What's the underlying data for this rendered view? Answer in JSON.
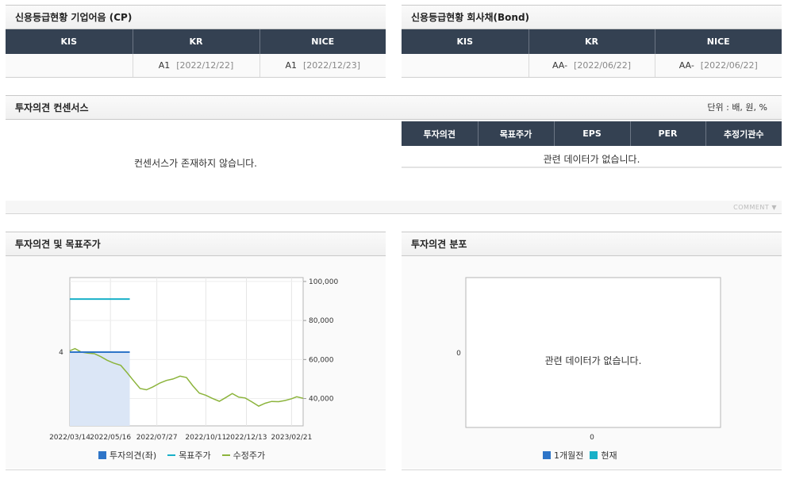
{
  "cp": {
    "title": "신용등급현황 기업어음 (CP)",
    "headers": [
      "KIS",
      "KR",
      "NICE"
    ],
    "row": [
      {
        "grade": "",
        "date": ""
      },
      {
        "grade": "A1",
        "date": "[2022/12/22]"
      },
      {
        "grade": "A1",
        "date": "[2022/12/23]"
      }
    ]
  },
  "bond": {
    "title": "신용등급현황 회사채(Bond)",
    "headers": [
      "KIS",
      "KR",
      "NICE"
    ],
    "row": [
      {
        "grade": "",
        "date": ""
      },
      {
        "grade": "AA-",
        "date": "[2022/06/22]"
      },
      {
        "grade": "AA-",
        "date": "[2022/06/22]"
      }
    ]
  },
  "consensus": {
    "title": "투자의견 컨센서스",
    "unit": "단위 : 배, 원, %",
    "empty_message": "컨센서스가 존재하지 않습니다.",
    "headers": [
      "투자의견",
      "목표주가",
      "EPS",
      "PER",
      "추정기관수"
    ],
    "no_data": "관련 데이터가 없습니다.",
    "comment_label": "COMMENT"
  },
  "opinion_chart": {
    "title": "투자의견 및 목표주가",
    "legend": [
      "투자의견(좌)",
      "목표주가",
      "수정주가"
    ]
  },
  "distribution": {
    "title": "투자의견 분포",
    "no_data": "관련 데이터가 없습니다.",
    "legend": [
      "1개월전",
      "현재"
    ]
  },
  "chart_data": [
    {
      "type": "line",
      "title": "투자의견 및 목표주가",
      "x_ticks": [
        "2022/03/14",
        "2022/05/16",
        "2022/07/27",
        "2022/10/11",
        "2022/12/13",
        "2023/02/21"
      ],
      "y_left_ticks": [
        "4"
      ],
      "y_right_ticks": [
        "100,000",
        "80,000",
        "60,000",
        "40,000"
      ],
      "ylim_right": [
        26000,
        102000
      ],
      "series": [
        {
          "name": "투자의견(좌)",
          "color": "#2e75c8",
          "start": "2022/03/14",
          "end": "2022/06/15",
          "value": 4
        },
        {
          "name": "목표주가",
          "color": "#18b0c8",
          "start": "2022/03/14",
          "end": "2022/06/15",
          "value": 91000
        },
        {
          "name": "수정주가",
          "color": "#8cb43c",
          "points": [
            [
              "2022/03/14",
              64500
            ],
            [
              "2022/03/22",
              65600
            ],
            [
              "2022/04/01",
              63800
            ],
            [
              "2022/04/11",
              63300
            ],
            [
              "2022/04/21",
              63000
            ],
            [
              "2022/05/01",
              61500
            ],
            [
              "2022/05/11",
              59600
            ],
            [
              "2022/05/21",
              58200
            ],
            [
              "2022/06/01",
              57000
            ],
            [
              "2022/06/11",
              53200
            ],
            [
              "2022/06/21",
              49100
            ],
            [
              "2022/07/01",
              45200
            ],
            [
              "2022/07/11",
              44500
            ],
            [
              "2022/07/21",
              46000
            ],
            [
              "2022/08/01",
              48000
            ],
            [
              "2022/08/11",
              49300
            ],
            [
              "2022/08/21",
              50000
            ],
            [
              "2022/09/01",
              51500
            ],
            [
              "2022/09/11",
              50800
            ],
            [
              "2022/09/21",
              46500
            ],
            [
              "2022/10/01",
              42800
            ],
            [
              "2022/10/11",
              41700
            ],
            [
              "2022/10/21",
              40100
            ],
            [
              "2022/11/01",
              38600
            ],
            [
              "2022/11/11",
              40500
            ],
            [
              "2022/11/21",
              42600
            ],
            [
              "2022/12/01",
              40700
            ],
            [
              "2022/12/11",
              40300
            ],
            [
              "2022/12/21",
              38400
            ],
            [
              "2023/01/01",
              36100
            ],
            [
              "2023/01/11",
              37600
            ],
            [
              "2023/01/21",
              38500
            ],
            [
              "2023/02/01",
              38400
            ],
            [
              "2023/02/11",
              39000
            ],
            [
              "2023/02/21",
              39900
            ],
            [
              "2023/03/01",
              40900
            ],
            [
              "2023/03/11",
              40100
            ]
          ]
        }
      ]
    },
    {
      "type": "bar",
      "title": "투자의견 분포",
      "x_ticks": [
        "0"
      ],
      "y_ticks": [
        "0"
      ],
      "series": [
        {
          "name": "1개월전",
          "color": "#2e75c8",
          "values": []
        },
        {
          "name": "현재",
          "color": "#18b0c8",
          "values": []
        }
      ]
    }
  ]
}
